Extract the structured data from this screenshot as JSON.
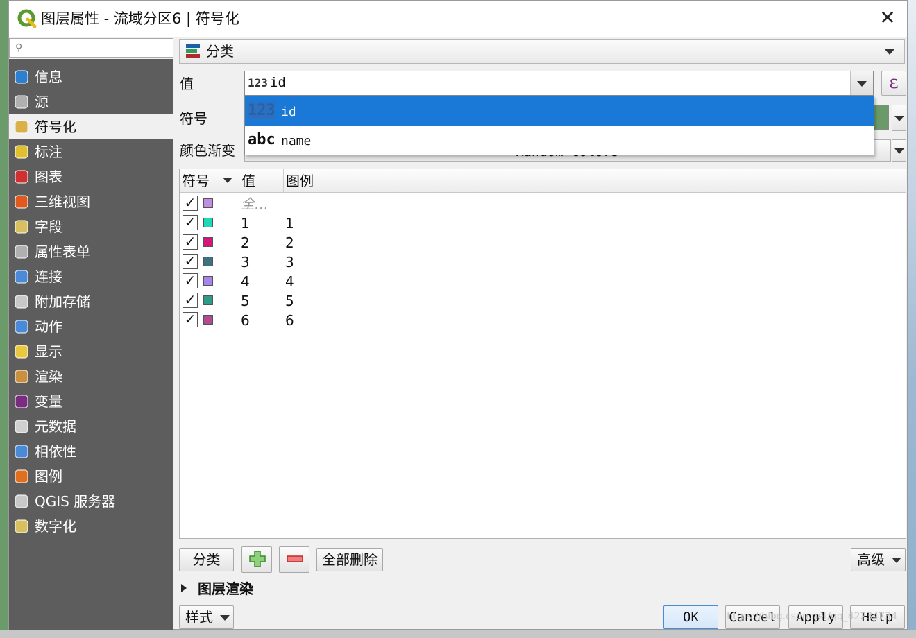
{
  "window": {
    "title": "图层属性 - 流域分区6 | 符号化",
    "close_symbol": "✕"
  },
  "search": {
    "placeholder": "",
    "icon": "search-icon"
  },
  "sidebar": {
    "items": [
      {
        "label": "信息",
        "icon": "info-icon",
        "active": false
      },
      {
        "label": "源",
        "icon": "source-icon",
        "active": false
      },
      {
        "label": "符号化",
        "icon": "symbology-icon",
        "active": true
      },
      {
        "label": "标注",
        "icon": "labels-icon",
        "active": false
      },
      {
        "label": "图表",
        "icon": "diagram-icon",
        "active": false
      },
      {
        "label": "三维视图",
        "icon": "3d-view-icon",
        "active": false
      },
      {
        "label": "字段",
        "icon": "fields-icon",
        "active": false
      },
      {
        "label": "属性表单",
        "icon": "attributes-form-icon",
        "active": false
      },
      {
        "label": "连接",
        "icon": "joins-icon",
        "active": false
      },
      {
        "label": "附加存储",
        "icon": "auxiliary-storage-icon",
        "active": false
      },
      {
        "label": "动作",
        "icon": "actions-icon",
        "active": false
      },
      {
        "label": "显示",
        "icon": "display-icon",
        "active": false
      },
      {
        "label": "渲染",
        "icon": "rendering-icon",
        "active": false
      },
      {
        "label": "变量",
        "icon": "variables-icon",
        "active": false
      },
      {
        "label": "元数据",
        "icon": "metadata-icon",
        "active": false
      },
      {
        "label": "相依性",
        "icon": "dependencies-icon",
        "active": false
      },
      {
        "label": "图例",
        "icon": "legend-icon",
        "active": false
      },
      {
        "label": "QGIS 服务器",
        "icon": "qgis-server-icon",
        "active": false
      },
      {
        "label": "数字化",
        "icon": "digitizing-icon",
        "active": false
      }
    ]
  },
  "renderer": {
    "selected": "分类"
  },
  "form": {
    "value_label": "值",
    "symbol_label": "符号",
    "ramp_label": "颜色渐变",
    "value_type_tag": "123",
    "value_selected": "id",
    "ramp_value": "Random colors",
    "epsilon": "ε"
  },
  "value_dropdown": {
    "options": [
      {
        "tag": "123",
        "label": "id",
        "selected": true
      },
      {
        "tag": "abc",
        "label": "name",
        "selected": false
      }
    ]
  },
  "table": {
    "headers": [
      "符号",
      "值",
      "图例"
    ],
    "rows": [
      {
        "checked": true,
        "color": "#c08ee0",
        "value": "全…",
        "legend": "",
        "is_all": true
      },
      {
        "checked": true,
        "color": "#1fd8b8",
        "value": "1",
        "legend": "1"
      },
      {
        "checked": true,
        "color": "#d8157a",
        "value": "2",
        "legend": "2"
      },
      {
        "checked": true,
        "color": "#3e7180",
        "value": "3",
        "legend": "3"
      },
      {
        "checked": true,
        "color": "#a486ea",
        "value": "4",
        "legend": "4"
      },
      {
        "checked": true,
        "color": "#2f9a88",
        "value": "5",
        "legend": "5"
      },
      {
        "checked": true,
        "color": "#b04a98",
        "value": "6",
        "legend": "6"
      }
    ],
    "check_symbol": "✓"
  },
  "buttons": {
    "classify": "分类",
    "delete_all": "全部删除",
    "advanced": "高级",
    "style": "样式",
    "ok": "OK",
    "cancel": "Cancel",
    "apply": "Apply",
    "help": "Help"
  },
  "section": {
    "layer_rendering": "图层渲染"
  },
  "watermark": "https://blog.csdn.net/qq_42234734",
  "colors": {
    "sidebar_bg": "#5d5d5d",
    "selection": "#1a78d7",
    "accent_plus": "#4a9a3a",
    "accent_minus": "#d83a3a"
  }
}
